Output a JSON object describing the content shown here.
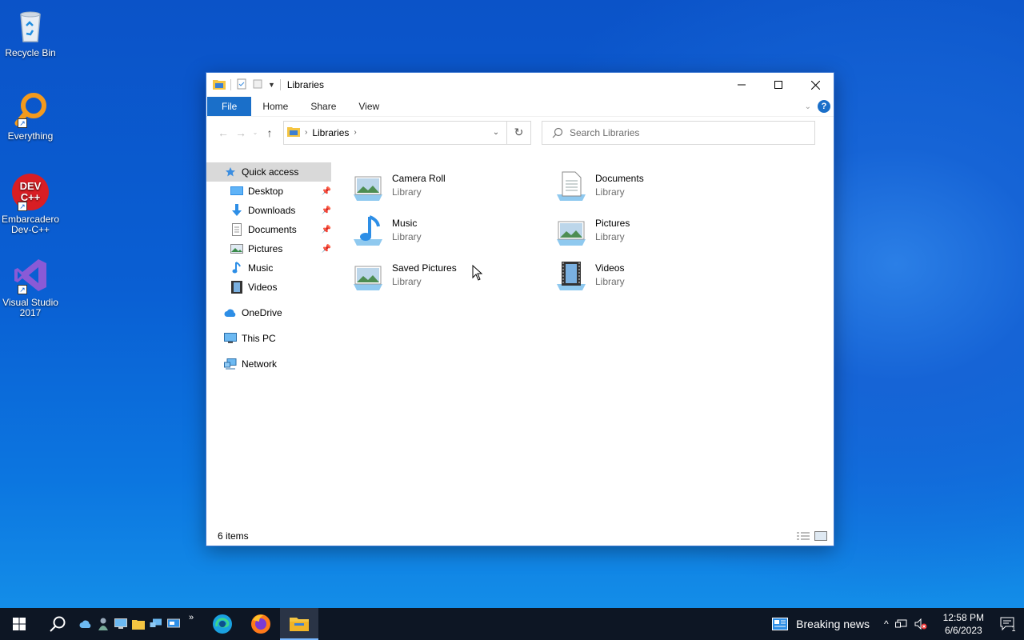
{
  "desktop": {
    "icons": [
      {
        "label": "Recycle Bin",
        "icon": "recycle-bin-icon"
      },
      {
        "label": "Everything",
        "icon": "everything-search-icon"
      },
      {
        "label": "Embarcadero Dev-C++",
        "icon": "dev-cpp-icon",
        "badge": "DEV C++"
      },
      {
        "label": "Visual Studio 2017",
        "icon": "visual-studio-icon"
      }
    ]
  },
  "window": {
    "title": "Libraries",
    "ribbon_tabs": [
      "File",
      "Home",
      "Share",
      "View"
    ],
    "address": {
      "crumb": "Libraries"
    },
    "search": {
      "placeholder": "Search Libraries"
    },
    "nav_pane": {
      "quick_access": "Quick access",
      "pinned": [
        {
          "label": "Desktop",
          "icon": "desktop-folder-icon"
        },
        {
          "label": "Downloads",
          "icon": "downloads-folder-icon"
        },
        {
          "label": "Documents",
          "icon": "documents-folder-icon"
        },
        {
          "label": "Pictures",
          "icon": "pictures-folder-icon"
        }
      ],
      "others": [
        {
          "label": "Music",
          "icon": "music-folder-icon"
        },
        {
          "label": "Videos",
          "icon": "videos-folder-icon"
        }
      ],
      "onedrive": "OneDrive",
      "this_pc": "This PC",
      "network": "Network"
    },
    "libraries": [
      {
        "name": "Camera Roll",
        "type": "Library",
        "icon": "camera-roll-library-icon"
      },
      {
        "name": "Documents",
        "type": "Library",
        "icon": "documents-library-icon"
      },
      {
        "name": "Music",
        "type": "Library",
        "icon": "music-library-icon"
      },
      {
        "name": "Pictures",
        "type": "Library",
        "icon": "pictures-library-icon"
      },
      {
        "name": "Saved Pictures",
        "type": "Library",
        "icon": "saved-pictures-library-icon"
      },
      {
        "name": "Videos",
        "type": "Library",
        "icon": "videos-library-icon"
      }
    ],
    "status": "6 items"
  },
  "taskbar": {
    "news": "Breaking news",
    "time": "12:58 PM",
    "date": "6/6/2023",
    "notification_count": "1"
  },
  "colors": {
    "accent": "#1a6fc9",
    "taskbar": "#0d1624",
    "desktop": "#0a5fd3"
  }
}
